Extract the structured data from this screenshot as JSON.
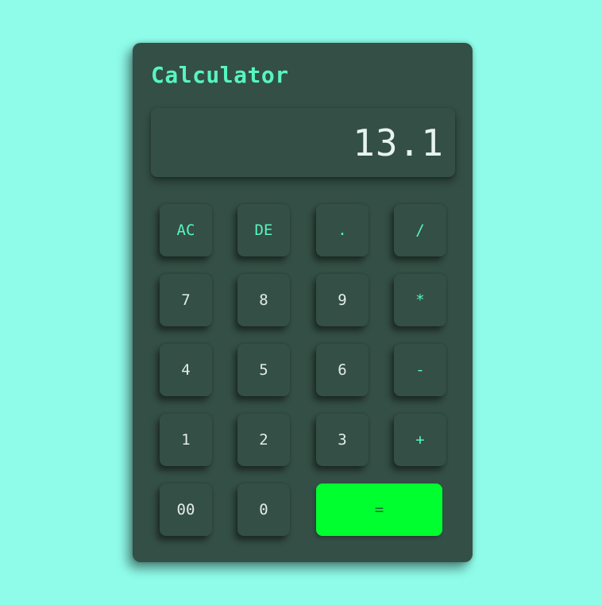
{
  "app": {
    "title": "Calculator"
  },
  "display": {
    "value": "13.1"
  },
  "keys": {
    "ac": "AC",
    "de": "DE",
    "dot": ".",
    "divide": "/",
    "seven": "7",
    "eight": "8",
    "nine": "9",
    "multiply": "*",
    "four": "4",
    "five": "5",
    "six": "6",
    "minus": "-",
    "one": "1",
    "two": "2",
    "three": "3",
    "plus": "+",
    "double_zero": "00",
    "zero": "0",
    "equals": "="
  },
  "colors": {
    "background": "#8ffcea",
    "panel": "#344f45",
    "accent": "#57f5c0",
    "equals": "#00ff2e"
  }
}
